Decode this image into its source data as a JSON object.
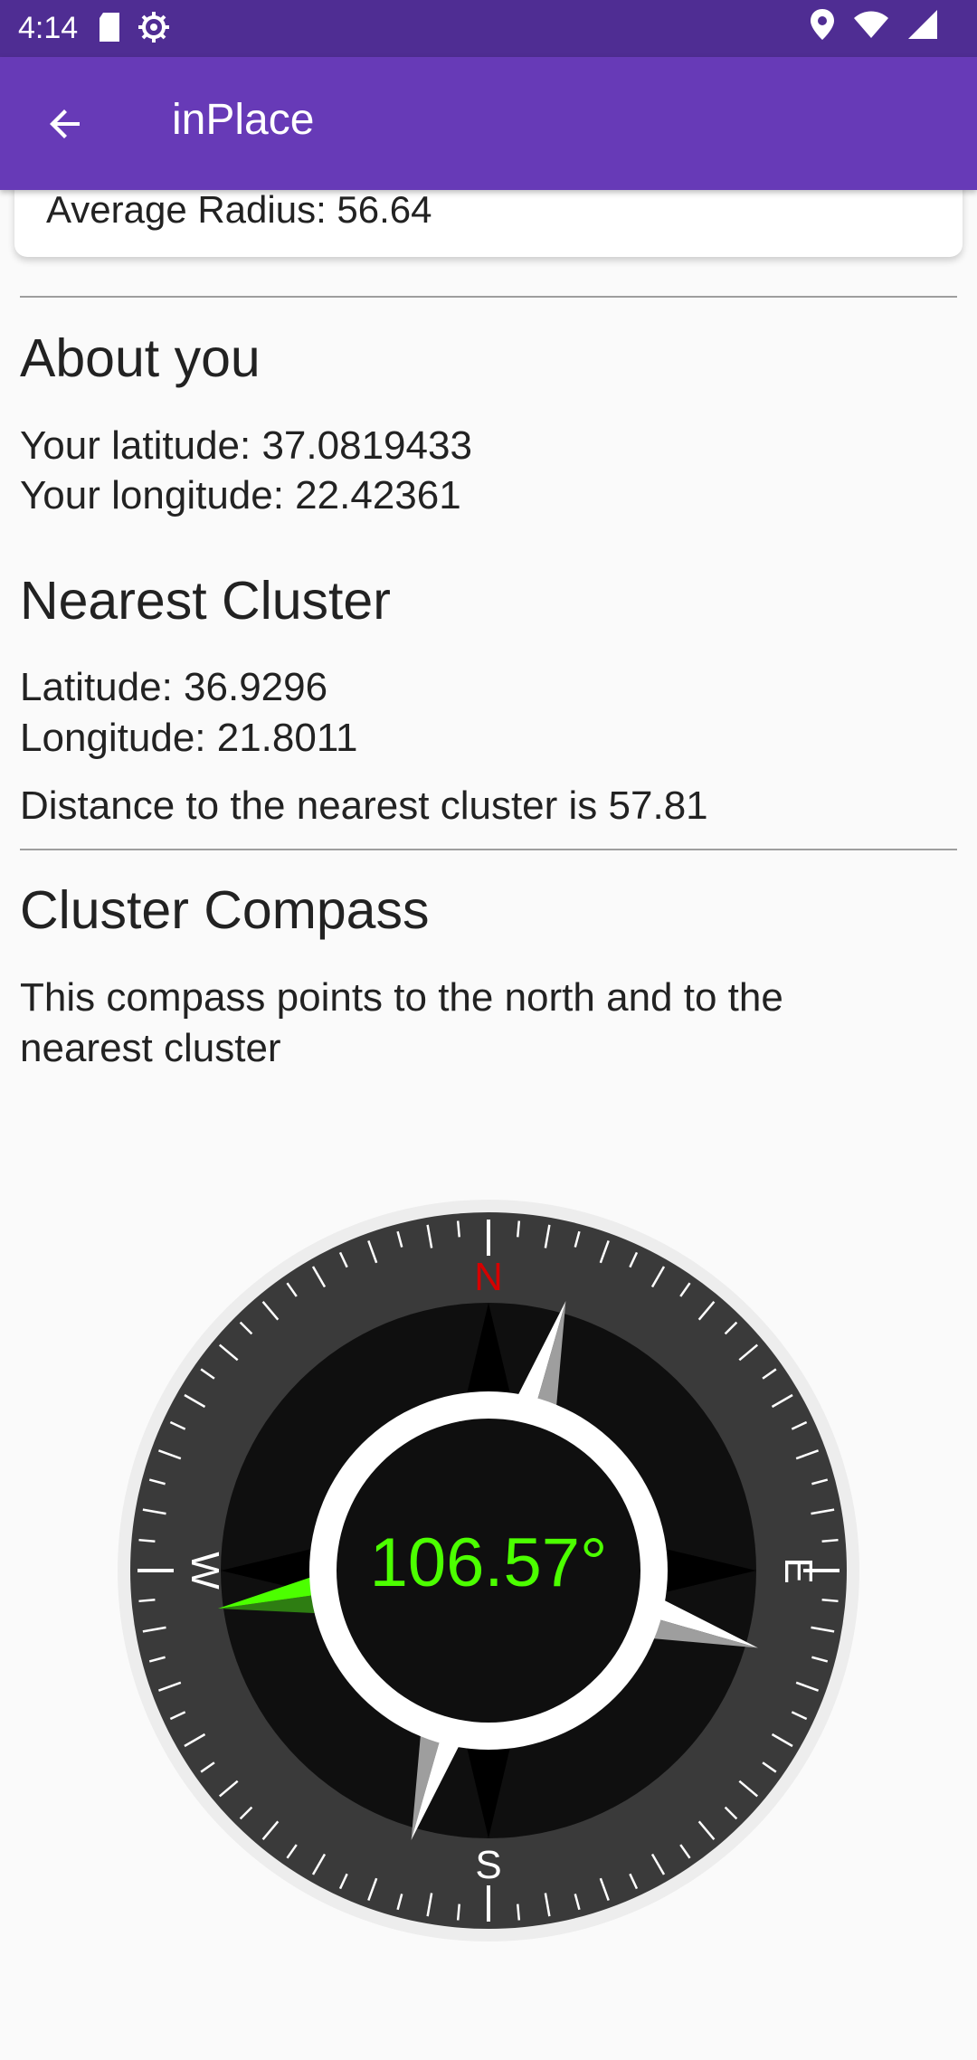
{
  "status_bar": {
    "time": "4:14",
    "icons": [
      "sd-card-icon",
      "settings-icon",
      "location-icon",
      "wifi-icon",
      "signal-icon"
    ]
  },
  "app_bar": {
    "title": "inPlace",
    "back_icon": "arrow-back-icon"
  },
  "summary_card": {
    "average_radius": "Average Radius: 56.64"
  },
  "about_you": {
    "heading": "About you",
    "latitude": "Your latitude: 37.0819433",
    "longitude": "Your longitude: 22.42361"
  },
  "nearest_cluster": {
    "heading": "Nearest Cluster",
    "latitude": "Latitude: 36.9296",
    "longitude": "Longitude: 21.8011",
    "distance": "Distance to the nearest cluster is 57.81"
  },
  "cluster_compass": {
    "heading": "Cluster Compass",
    "description": "This compass points to the north and to the nearest cluster",
    "heading_value": "106.57°",
    "north_label": "N",
    "east_label": "E",
    "south_label": "S",
    "west_label": "W",
    "colors": {
      "north": "#d50000",
      "pointer": "#4cff00",
      "dial": "#3a3a3a",
      "face": "#0f0f0f",
      "ring": "#ffffff"
    }
  }
}
